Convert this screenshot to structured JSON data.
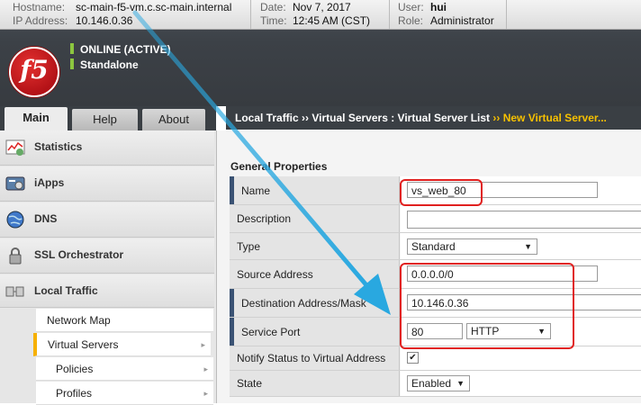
{
  "header": {
    "hostname_label": "Hostname:",
    "hostname": "sc-main-f5-vm.c.sc-main.internal",
    "ip_label": "IP Address:",
    "ip": "10.146.0.36",
    "date_label": "Date:",
    "date": "Nov 7, 2017",
    "time_label": "Time:",
    "time": "12:45 AM (CST)",
    "user_label": "User:",
    "user": "hui",
    "role_label": "Role:",
    "role": "Administrator",
    "logo_text": "f5",
    "status_online": "ONLINE (ACTIVE)",
    "status_mode": "Standalone"
  },
  "tabs": [
    {
      "label": "Main",
      "active": true
    },
    {
      "label": "Help",
      "active": false
    },
    {
      "label": "About",
      "active": false
    }
  ],
  "breadcrumb": {
    "part1": "Local Traffic",
    "sep1": "››",
    "part2": "Virtual Servers : Virtual Server List",
    "sep2": "››",
    "current": "New Virtual Server..."
  },
  "sidebar": {
    "sections": [
      {
        "label": "Statistics",
        "icon": "statistics-icon"
      },
      {
        "label": "iApps",
        "icon": "iapps-icon"
      },
      {
        "label": "DNS",
        "icon": "dns-globe-icon"
      },
      {
        "label": "SSL Orchestrator",
        "icon": "lock-icon"
      },
      {
        "label": "Local Traffic",
        "icon": "local-traffic-icon"
      }
    ],
    "subitems": [
      {
        "label": "Network Map",
        "arrow": false
      },
      {
        "label": "Virtual Servers",
        "arrow": true,
        "active": true
      },
      {
        "label": "Policies",
        "arrow": true
      },
      {
        "label": "Profiles",
        "arrow": true
      }
    ],
    "arrow_glyph": "▸"
  },
  "form": {
    "section_title": "General Properties",
    "rows": {
      "name": {
        "label": "Name",
        "value": "vs_web_80"
      },
      "description": {
        "label": "Description",
        "value": ""
      },
      "type": {
        "label": "Type",
        "value": "Standard"
      },
      "source": {
        "label": "Source Address",
        "value": "0.0.0.0/0"
      },
      "destination": {
        "label": "Destination Address/Mask",
        "value": "10.146.0.36"
      },
      "service_port": {
        "label": "Service Port",
        "port": "80",
        "protocol": "HTTP"
      },
      "notify": {
        "label": "Notify Status to Virtual Address",
        "checked": "✔"
      },
      "state": {
        "label": "State",
        "value": "Enabled"
      }
    },
    "dropdown_glyph": "▼"
  },
  "colors": {
    "accent_yellow": "#f6c000",
    "annotation_red": "#e0201f",
    "annotation_arrow": "#29a8e0",
    "status_green": "#8cc63f"
  }
}
